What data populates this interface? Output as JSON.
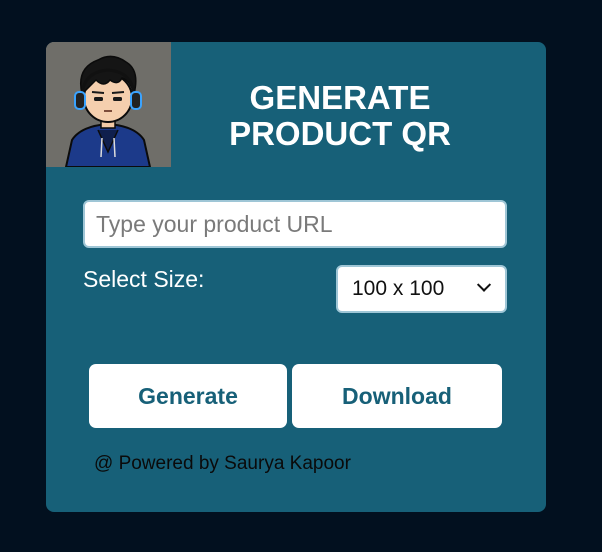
{
  "header": {
    "avatar_icon": "avatar-icon",
    "title_line1": "GENERATE",
    "title_line2": "PRODUCT QR"
  },
  "form": {
    "url_placeholder": "Type your product URL",
    "url_value": "",
    "size_label": "Select Size:",
    "size_selected": "100 x 100",
    "dropdown_icon": "chevron-down-icon"
  },
  "actions": {
    "generate_label": "Generate",
    "download_label": "Download"
  },
  "footer": {
    "credit": "@ Powered by Saurya Kapoor"
  },
  "colors": {
    "page_background": "#02101f",
    "card_background": "#176078",
    "button_background": "#ffffff",
    "button_text": "#176078"
  }
}
